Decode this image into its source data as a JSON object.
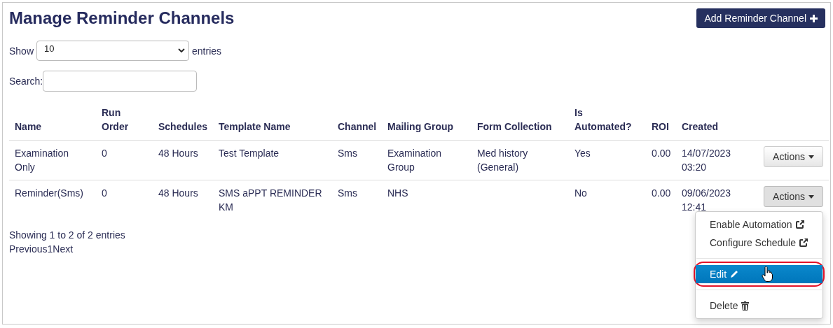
{
  "page": {
    "title": "Manage Reminder Channels",
    "add_button": "Add Reminder Channel"
  },
  "length_control": {
    "prefix": "Show",
    "value": "10",
    "suffix": "entries"
  },
  "search": {
    "label": "Search:"
  },
  "table": {
    "columns": [
      "Name",
      "Run Order",
      "Schedules",
      "Template Name",
      "Channel",
      "Mailing Group",
      "Form Collection",
      "Is Automated?",
      "ROI",
      "Created"
    ],
    "rows": [
      {
        "cells": [
          "Examination Only",
          "0",
          "48 Hours",
          "Test Template",
          "Sms",
          "Examination Group",
          "Med history (General)",
          "Yes",
          "0.00",
          "14/07/2023 03:20"
        ],
        "actions": "Actions",
        "open": false
      },
      {
        "cells": [
          "Reminder(Sms)",
          "0",
          "48 Hours",
          "SMS aPPT REMINDER KM",
          "Sms",
          "NHS",
          "",
          "No",
          "0.00",
          "09/06/2023 12:41"
        ],
        "actions": "Actions",
        "open": true
      }
    ]
  },
  "actions_menu": {
    "items": [
      {
        "kind": "external",
        "label": "Enable Automation",
        "selected": false
      },
      {
        "kind": "external",
        "label": "Configure Schedule",
        "selected": false
      },
      {
        "kind": "divider"
      },
      {
        "kind": "edit",
        "label": "Edit",
        "selected": true
      },
      {
        "kind": "divider"
      },
      {
        "kind": "delete",
        "label": "Delete",
        "selected": false
      }
    ]
  },
  "info": "Showing 1 to 2 of 2 entries",
  "pagination": [
    {
      "label": "Previous"
    },
    {
      "label": "1"
    },
    {
      "label": "Next"
    }
  ]
}
